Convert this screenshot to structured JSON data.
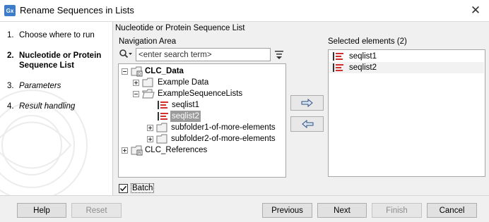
{
  "window": {
    "app_icon_text": "Gx",
    "title": "Rename Sequences in Lists",
    "close_glyph": "✕"
  },
  "steps": [
    {
      "num": "1.",
      "label": "Choose where to run",
      "style": "normal"
    },
    {
      "num": "2.",
      "label": "Nucleotide or Protein Sequence List",
      "style": "bold"
    },
    {
      "num": "3.",
      "label": "Parameters",
      "style": "italic"
    },
    {
      "num": "4.",
      "label": "Result handling",
      "style": "italic"
    }
  ],
  "main": {
    "section_title": "Nucleotide or Protein Sequence List",
    "navigation_label": "Navigation Area",
    "search": {
      "placeholder": "<enter search term>",
      "value": ""
    },
    "tree": [
      {
        "label": "CLC_Data",
        "icon": "database-icon",
        "bold": true,
        "expander": "minus"
      },
      {
        "label": "Example Data",
        "icon": "folder-icon",
        "expander": "plus"
      },
      {
        "label": "ExampleSequenceLists",
        "icon": "open-folder-icon",
        "expander": "minus"
      },
      {
        "label": "seqlist1",
        "icon": "sequence-list-icon",
        "expander": "none"
      },
      {
        "label": "seqlist2",
        "icon": "sequence-list-icon",
        "expander": "none",
        "selected": true
      },
      {
        "label": "subfolder1-of-more-elements",
        "icon": "folder-icon",
        "expander": "plus"
      },
      {
        "label": "subfolder2-of-more-elements",
        "icon": "folder-icon",
        "expander": "plus"
      },
      {
        "label": "CLC_References",
        "icon": "reference-database-icon",
        "bold": false,
        "expander": "plus"
      }
    ],
    "add_arrow": "→",
    "remove_arrow": "←",
    "selected_label": "Selected elements (2)",
    "selected_items": [
      {
        "label": "seqlist1",
        "icon": "sequence-list-icon"
      },
      {
        "label": "seqlist2",
        "icon": "sequence-list-icon"
      }
    ],
    "batch_label": "Batch",
    "batch_checked": true
  },
  "footer": {
    "help": "Help",
    "reset": "Reset",
    "previous": "Previous",
    "next": "Next",
    "finish": "Finish",
    "cancel": "Cancel"
  },
  "colors": {
    "sequence_list_red": "#d32f2f",
    "selection_gray": "#9b9b9b",
    "app_icon_blue": "#3d7cc9"
  }
}
